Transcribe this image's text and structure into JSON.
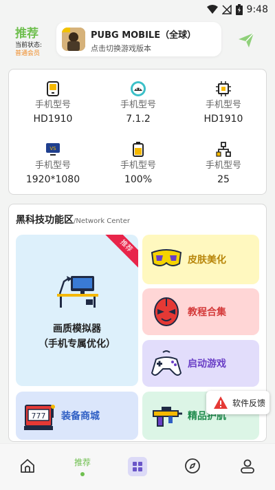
{
  "status_bar": {
    "time": "9:48"
  },
  "header": {
    "section_title": "推荐",
    "status_label": "当前状态:",
    "member_status": "普通会员",
    "game": {
      "title": "PUBG MOBILE（全球）",
      "subtitle": "点击切换游戏版本"
    }
  },
  "device_info": [
    {
      "icon": "sim-card-icon",
      "label": "手机型号",
      "value": "HD1910"
    },
    {
      "icon": "android-icon",
      "label": "手机型号",
      "value": "7.1.2"
    },
    {
      "icon": "cpu-chip-icon",
      "label": "手机型号",
      "value": "HD1910"
    },
    {
      "icon": "monitor-vs-icon",
      "label": "手机型号",
      "value": "1920*1080"
    },
    {
      "icon": "battery-icon",
      "label": "手机型号",
      "value": "100%"
    },
    {
      "icon": "network-icon",
      "label": "手机型号",
      "value": "25"
    }
  ],
  "tech_section": {
    "title": "黑科技功能区",
    "subtitle": "/Network Center",
    "recommend_badge": "推荐",
    "tiles": {
      "graphics": {
        "title": "画质模拟器",
        "subtitle": "（手机专属优化）",
        "color": "#ddf0fb"
      },
      "skin": {
        "label": "皮肤美化",
        "color": "#fff8bf",
        "text_color": "#b8860b"
      },
      "tutorial": {
        "label": "教程合集",
        "color": "#ffd6d6",
        "text_color": "#d43a3a"
      },
      "launch": {
        "label": "启动游戏",
        "color": "#e2ddfb",
        "text_color": "#6a3fc6"
      },
      "shop": {
        "label": "装备商城",
        "color": "#dbe6fb",
        "text_color": "#2f5fc4"
      },
      "essentials": {
        "label": "精品护肌",
        "color": "#dcf5e6",
        "text_color": "#1e8a4c"
      }
    }
  },
  "feedback": {
    "label": "软件反馈"
  },
  "bottom_nav": {
    "active_label": "推荐"
  },
  "colors": {
    "accent": "#6fbf4f",
    "member": "#f08a24",
    "badge": "#e8254a"
  }
}
